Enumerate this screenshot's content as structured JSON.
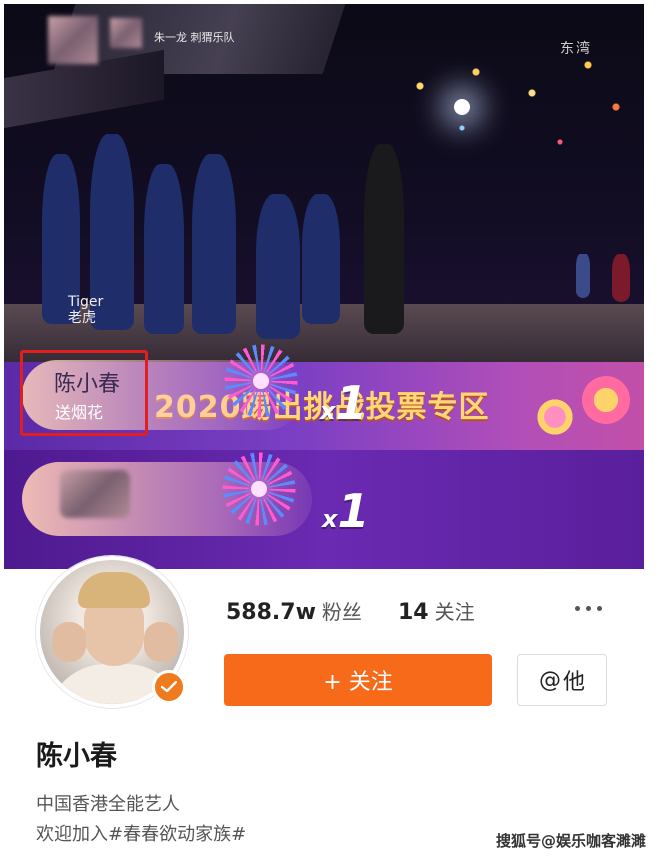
{
  "video": {
    "top_caption": "朱一龙 刺猬乐队",
    "channel_logo": "东湾",
    "tiger_en": "Tiger",
    "tiger_cn": "老虎"
  },
  "gift_banner_1": {
    "title": "2020踢出挑战投票专区",
    "sender_name": "陈小春",
    "sender_action": "送烟花",
    "count_prefix": "x",
    "count_value": "1"
  },
  "gift_banner_2": {
    "count_prefix": "x",
    "count_value": "1"
  },
  "profile": {
    "followers_value": "588.7w",
    "followers_label": "粉丝",
    "following_value": "14",
    "following_label": "关注",
    "follow_button": "+ 关注",
    "at_button_symbol": "@",
    "at_button_label": "他",
    "name": "陈小春",
    "bio_line_1": "中国香港全能艺人",
    "bio_line_2": "欢迎加入#春春欲动家族#"
  },
  "watermark": "搜狐号@娱乐咖客濉濉",
  "colors": {
    "accent_orange": "#f76a1a",
    "highlight_red": "#e02020",
    "banner_purple": "#6a2ab2",
    "title_gold": "#ffd774"
  },
  "icons": [
    "verified-badge-icon",
    "more-icon",
    "firework-icon"
  ]
}
